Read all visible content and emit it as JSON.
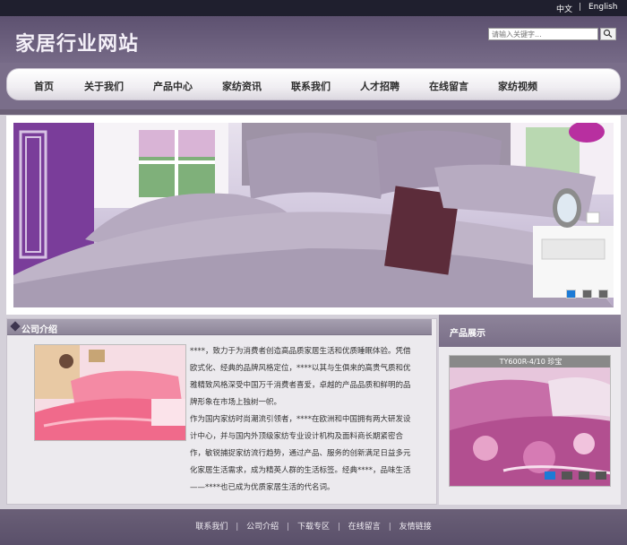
{
  "topbar": {
    "lang_cn": "中文",
    "separator": "|",
    "lang_en": "English"
  },
  "header": {
    "site_title": "家居行业网站"
  },
  "search": {
    "placeholder": "请输入关键字...",
    "button_icon": "search-icon"
  },
  "nav": {
    "items": [
      {
        "label": "首页"
      },
      {
        "label": "关于我们"
      },
      {
        "label": "产品中心"
      },
      {
        "label": "家纺资讯"
      },
      {
        "label": "联系我们"
      },
      {
        "label": "人才招聘"
      },
      {
        "label": "在线留言"
      },
      {
        "label": "家纺视频"
      }
    ]
  },
  "banner": {
    "slide_count": 3,
    "active_slide": 1
  },
  "about": {
    "title": "公司介绍",
    "paragraphs": [
      "****，致力于为消费者创造高品质家居生活和优质睡眠体验。凭借欧式化、经典的品牌风格定位，****以其与生俱来的高贵气质和优雅精致风格深受中国万千消费者喜爱，卓越的产品品质和鲜明的品牌形象在市场上独树一帜。",
      "作为国内家纺时尚潮流引领者，****在欧洲和中国拥有两大研发设计中心，并与国内外顶级家纺专业设计机构及面料商长期紧密合作，敏锐捕捉家纺流行趋势，通过产品、服务的创新满足日益多元化家居生活需求，成为精英人群的生活标签。经典****，品味生活——****也已成为优质家居生活的代名词。"
    ]
  },
  "products": {
    "title": "产品展示",
    "caption": "TY600R-4/10 珍宝",
    "slide_count": 4,
    "active_slide": 1
  },
  "footer": {
    "links": [
      {
        "label": "联系我们"
      },
      {
        "label": "公司介绍"
      },
      {
        "label": "下载专区"
      },
      {
        "label": "在线留言"
      },
      {
        "label": "友情链接"
      }
    ],
    "separator": "|"
  }
}
